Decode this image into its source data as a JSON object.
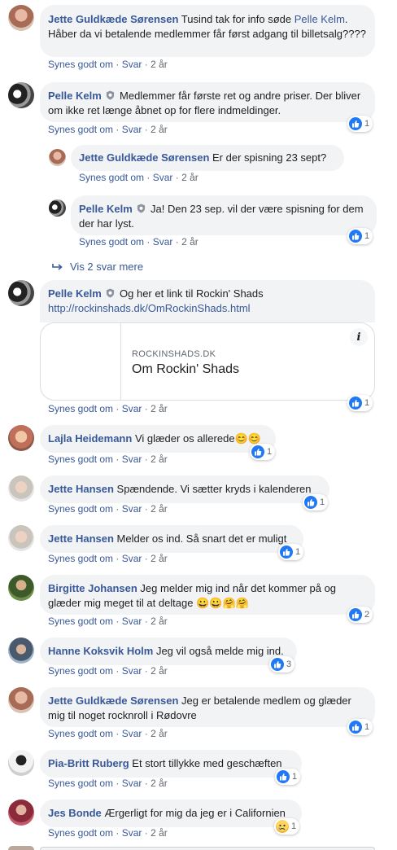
{
  "colors": {
    "link": "#385898",
    "bubble": "#f2f3f5",
    "like": "#2078f4",
    "meta": "#606770"
  },
  "actions": {
    "like": "Synes godt om",
    "reply": "Svar",
    "sep": "·"
  },
  "comments": [
    {
      "author": "Jette Guldkæde Sørensen",
      "text_a": "Tusind tak for info søde ",
      "mention": "Pelle Kelm",
      "text_b": ". Håber da vi betalende medlemmer får først adgang til billetsalg????",
      "time": "2 år"
    },
    {
      "author": "Pelle Kelm",
      "text": "Medlemmer får første ret og andre priser. Der bliver om ikke ret længe åbnet op for flere indmeldinger.",
      "time": "2 år",
      "reaction": "1",
      "reaction_type": "like-icon"
    },
    {
      "author": "Jette Guldkæde Sørensen",
      "text": "Er der spisning 23 sept?",
      "time": "2 år"
    },
    {
      "author": "Pelle Kelm",
      "text": "Ja! Den 23 sep. vil der være spisning for dem der har lyst.",
      "time": "2 år",
      "reaction": "1",
      "reaction_type": "like-icon"
    },
    {
      "author": "Pelle Kelm",
      "text": "Og her et link til Rockin' Shads",
      "link": "http://rockinshads.dk/OmRockinShads.html",
      "time": "2 år",
      "reaction": "1",
      "reaction_type": "like-icon"
    },
    {
      "author": "Lajla Heidemann",
      "text": "Vi glæder os allerede",
      "emoji": "😊😊",
      "time": "2 år",
      "reaction": "1",
      "reaction_type": "like-icon"
    },
    {
      "author": "Jette Hansen",
      "text": "Spændende. Vi sætter kryds i kalenderen",
      "time": "2 år",
      "reaction": "1",
      "reaction_type": "like-icon"
    },
    {
      "author": "Jette Hansen",
      "text": "Melder os ind. Så snart det er muligt",
      "time": "2 år",
      "reaction": "1",
      "reaction_type": "like-icon"
    },
    {
      "author": "Birgitte Johansen",
      "text": "Jeg melder mig ind når det kommer på og glæder mig meget til at deltage",
      "emoji": "😀😀🤗🤗",
      "time": "2 år",
      "reaction": "2",
      "reaction_type": "like-icon"
    },
    {
      "author": "Hanne Koksvik Holm",
      "text": "Jeg vil også melde mig ind.",
      "time": "2 år",
      "reaction": "3",
      "reaction_type": "like-icon"
    },
    {
      "author": "Jette Guldkæde Sørensen",
      "text": "Jeg er betalende medlem og glæder mig til noget rocknroll i Rødovre",
      "time": "2 år",
      "reaction": "1",
      "reaction_type": "like-icon"
    },
    {
      "author": "Pia-Britt Ruberg",
      "text": "Et stort tillykke med geschæften",
      "time": "2 år",
      "reaction": "1",
      "reaction_type": "like-icon"
    },
    {
      "author": "Jes Bonde",
      "text": "Ærgerligt for mig da jeg er i Californien",
      "time": "2 år",
      "reaction": "1",
      "reaction_type": "sad-icon"
    }
  ],
  "more_replies": {
    "icon": "reply-arrow-icon",
    "label": "Vis 2 svar mere"
  },
  "preview": {
    "domain": "ROCKINSHADS.DK",
    "title": "Om Rockin' Shads",
    "info_icon": "info-icon",
    "info_glyph": "i"
  }
}
